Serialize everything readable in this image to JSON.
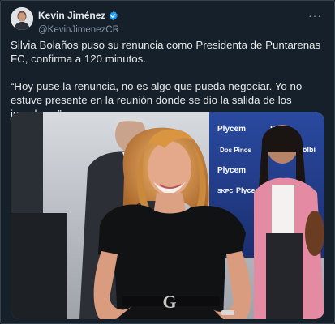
{
  "author": {
    "display_name": "Kevin Jiménez",
    "handle": "@KevinJimenezCR",
    "verified": true
  },
  "menu": {
    "more_label": "···"
  },
  "tweet": {
    "paragraphs": [
      "Silvia Bolaños puso su renuncia como Presidenta de Puntarenas FC, confirma a 120 minutos.",
      "“Hoy puse la renuncia, no es algo que pueda negociar. Yo no estuve presente en la reunión donde se dio la salida de los jugadores”."
    ]
  },
  "media": {
    "banner_texts": [
      "Plycem",
      "Sca",
      "Plycem",
      "Plycem",
      "kölbi",
      "Dos Pinos",
      "SKPC"
    ],
    "belt_buckle": "G"
  },
  "colors": {
    "background": "#15202b",
    "text": "#e7e9ea",
    "secondary_text": "#8b98a5",
    "verified_blue": "#1d9bf0",
    "banner_blue": "#1f3a8a"
  },
  "icons": {
    "verified": "verified-badge-icon",
    "more": "more-options-icon"
  }
}
